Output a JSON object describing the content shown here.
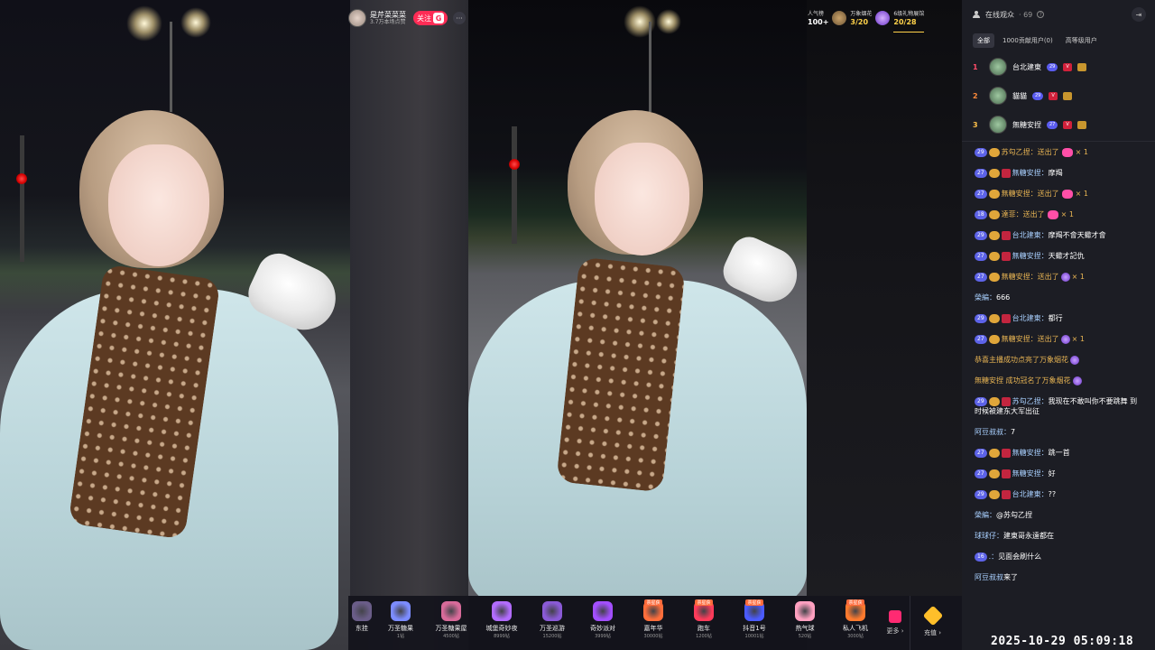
{
  "anchor": {
    "name": "是芹菜菜菜",
    "sub": "3.7万本场点赞",
    "follow_label": "关注",
    "follow_badge": "G",
    "more": "···"
  },
  "stats": {
    "popularity_label": "人气榜",
    "popularity_value": "100+",
    "fireworks_label": "万象烟花",
    "fireworks_value": "3/20",
    "group_label": "6级礼物展馆",
    "group_value": "20/28"
  },
  "gifts": [
    {
      "name": "东挂",
      "price": "",
      "tag": ""
    },
    {
      "name": "万圣糖果",
      "price": "1钻",
      "tag": ""
    },
    {
      "name": "万圣糖果屋",
      "price": "4500钻",
      "tag": ""
    },
    {
      "name": "城堡奇妙夜",
      "price": "8999钻",
      "tag": ""
    },
    {
      "name": "万圣巡游",
      "price": "15200钻",
      "tag": ""
    },
    {
      "name": "奇妙派对",
      "price": "3999钻",
      "tag": ""
    },
    {
      "name": "嘉年华",
      "price": "30000钻",
      "tag": "票星获"
    },
    {
      "name": "跑车",
      "price": "1200钻",
      "tag": "票星获"
    },
    {
      "name": "抖音1号",
      "price": "10001钻",
      "tag": "票星获"
    },
    {
      "name": "热气球",
      "price": "520钻",
      "tag": ""
    },
    {
      "name": "私人飞机",
      "price": "3000钻",
      "tag": "票星获"
    }
  ],
  "gift_more_label": "更多 ›",
  "recharge_label": "充值 ›",
  "panel": {
    "title": "在线观众",
    "count": "· 69",
    "tabs": [
      "全部",
      "1000贡献用户(0)",
      "高等级用户"
    ],
    "ranks": [
      {
        "no": "1",
        "name": "台北建東",
        "lv": "29"
      },
      {
        "no": "2",
        "name": "貓貓",
        "lv": "29"
      },
      {
        "no": "3",
        "name": "無糖安捏",
        "lv": "27"
      }
    ]
  },
  "chat": [
    {
      "lv": "29",
      "fan": true,
      "vb": false,
      "user": "苏勾乙捏",
      "sep": "：",
      "text": "送出了",
      "gift": "heart",
      "suffix": "× 1",
      "kind": "gift"
    },
    {
      "lv": "27",
      "fan": true,
      "vb": true,
      "user": "無糖安捏",
      "sep": "：",
      "text": "摩羯",
      "kind": "msg"
    },
    {
      "lv": "27",
      "fan": true,
      "vb": false,
      "user": "無糖安捏",
      "sep": "：",
      "text": "送出了",
      "gift": "heart",
      "suffix": "× 1",
      "kind": "gift"
    },
    {
      "lv": "18",
      "fan": true,
      "vb": false,
      "user": "達菲",
      "sep": "：",
      "text": "送出了",
      "gift": "heart",
      "suffix": "× 1",
      "kind": "gift"
    },
    {
      "lv": "29",
      "fan": true,
      "vb": true,
      "user": "台北建東",
      "sep": "：",
      "text": "摩羯不會天蠍才會",
      "kind": "msg"
    },
    {
      "lv": "27",
      "fan": true,
      "vb": true,
      "user": "無糖安捏",
      "sep": "：",
      "text": "天蠍才記仇",
      "kind": "msg"
    },
    {
      "lv": "27",
      "fan": true,
      "vb": false,
      "user": "無糖安捏",
      "sep": "：",
      "text": "送出了",
      "gift": "orb",
      "suffix": "× 1",
      "kind": "gift"
    },
    {
      "lv": "",
      "fan": false,
      "vb": false,
      "user": "榮編",
      "sep": "：",
      "text": "666",
      "kind": "plain"
    },
    {
      "lv": "29",
      "fan": true,
      "vb": true,
      "user": "台北建東",
      "sep": "：",
      "text": "都行",
      "kind": "msg"
    },
    {
      "lv": "27",
      "fan": true,
      "vb": false,
      "user": "無糖安捏",
      "sep": "：",
      "text": "送出了",
      "gift": "orb",
      "suffix": "× 1",
      "kind": "gift"
    },
    {
      "kind": "sys",
      "text": "恭喜主播成功点亮了万象烟花"
    },
    {
      "kind": "sys",
      "text": "無糖安捏 成功冠名了万象烟花"
    },
    {
      "lv": "29",
      "fan": true,
      "vb": true,
      "user": "苏勾乙捏",
      "sep": "：",
      "text": "我现在不敢叫你不要跳舞 到时候被建东大军出征",
      "kind": "msg"
    },
    {
      "lv": "",
      "fan": false,
      "vb": false,
      "user": "阿豆叔叔",
      "sep": "：",
      "text": "7",
      "kind": "plain"
    },
    {
      "lv": "27",
      "fan": true,
      "vb": true,
      "user": "無糖安捏",
      "sep": "：",
      "text": "跳一首",
      "kind": "msg"
    },
    {
      "lv": "27",
      "fan": true,
      "vb": true,
      "user": "無糖安捏",
      "sep": "：",
      "text": "好",
      "kind": "msg"
    },
    {
      "lv": "29",
      "fan": true,
      "vb": true,
      "user": "台北建東",
      "sep": "：",
      "text": "??",
      "kind": "msg"
    },
    {
      "lv": "",
      "fan": false,
      "vb": false,
      "user": "榮編",
      "sep": "：",
      "text": "@苏勾乙捏",
      "kind": "plain"
    },
    {
      "lv": "",
      "fan": false,
      "vb": false,
      "user": "球球仔",
      "sep": "：",
      "text": "建東哥永遠都在",
      "kind": "plain"
    },
    {
      "lv": "16",
      "fan": false,
      "vb": false,
      "user": "",
      "sep": ".：",
      "text": "见面会刷什么",
      "kind": "msg"
    },
    {
      "lv": "",
      "fan": false,
      "vb": false,
      "user": "阿豆叔叔",
      "sep": "",
      "text": "来了",
      "kind": "plain"
    }
  ],
  "timestamp": "2025-10-29 05:09:18",
  "colors": {
    "accent": "#fe2c55",
    "panel_bg": "#1c1d24",
    "gold": "#e7b453",
    "level": "#5d63e8"
  }
}
